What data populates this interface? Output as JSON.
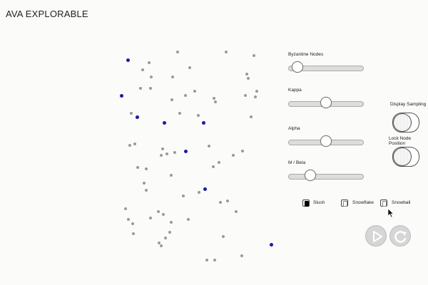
{
  "app": {
    "title": "AVA EXPLORABLE"
  },
  "sliders": [
    {
      "label": "Byzantine Nodes",
      "value_fraction": 0.06
    },
    {
      "label": "Kappa",
      "value_fraction": 0.5
    },
    {
      "label": "Alpha",
      "value_fraction": 0.5
    },
    {
      "label": "M / Beta",
      "value_fraction": 0.26
    }
  ],
  "toggles": [
    {
      "label": "Display Sampling",
      "on": false
    },
    {
      "label": "Lock Node Position",
      "on": false
    }
  ],
  "protocols": [
    {
      "label": "Slush",
      "selected": true
    },
    {
      "label": "Snowflake",
      "selected": false
    },
    {
      "label": "Snowball",
      "selected": false
    }
  ],
  "controls": {
    "play_icon": "play-icon",
    "reset_icon": "reset-icon"
  },
  "colors": {
    "byzantine_node": "#1a1aa6",
    "honest_node": "#999999"
  }
}
